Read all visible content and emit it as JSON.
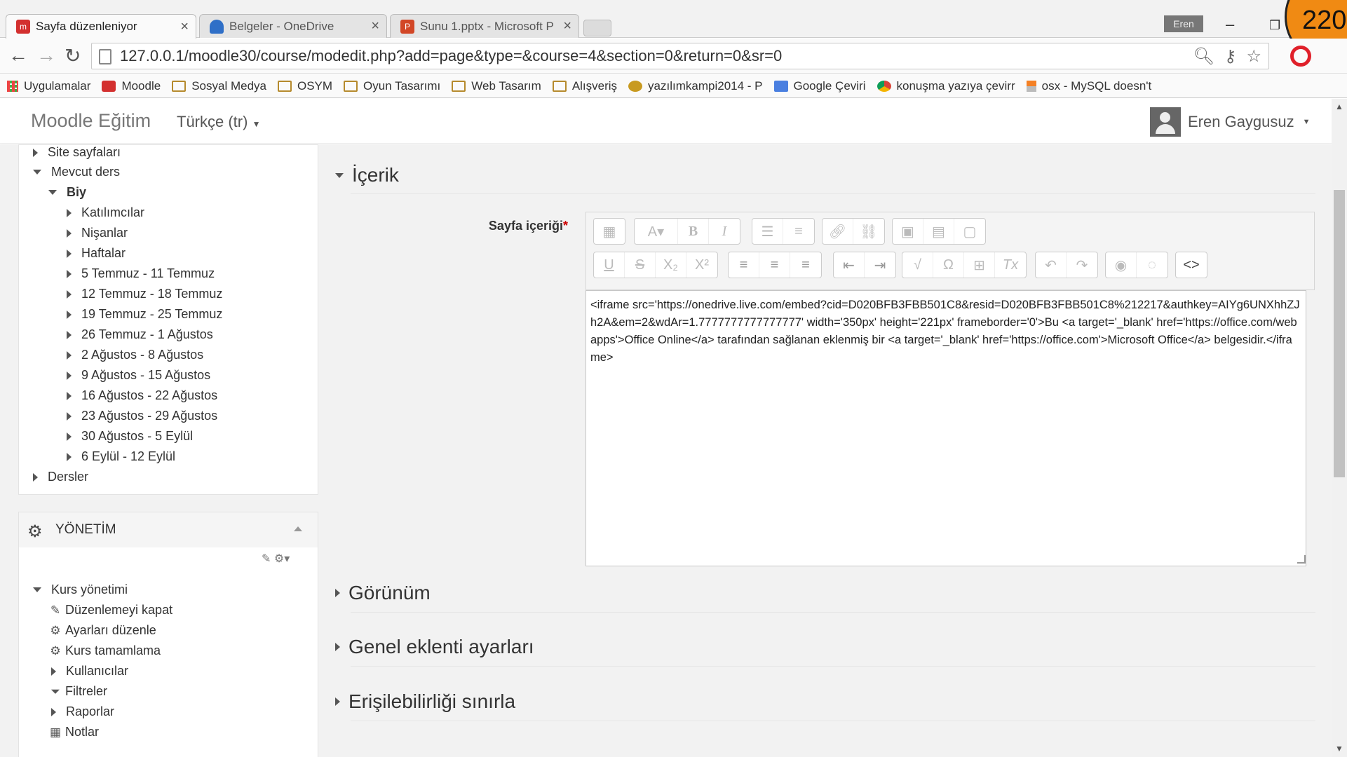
{
  "browser": {
    "tabs": [
      {
        "title": "Sayfa düzenleniyor",
        "favicon": "moodle-icon"
      },
      {
        "title": "Belgeler - OneDrive",
        "favicon": "onedrive-icon"
      },
      {
        "title": "Sunu 1.pptx - Microsoft P",
        "favicon": "powerpoint-icon"
      }
    ],
    "user_chip": "Eren",
    "url": "127.0.0.1/moodle30/course/modedit.php?add=page&type=&course=4&section=0&return=0&sr=0",
    "overlay_badge": "220",
    "bookmarks": [
      {
        "label": "Uygulamalar"
      },
      {
        "label": "Moodle"
      },
      {
        "label": "Sosyal Medya"
      },
      {
        "label": "OSYM"
      },
      {
        "label": "Oyun Tasarımı"
      },
      {
        "label": "Web Tasarım"
      },
      {
        "label": "Alışveriş"
      },
      {
        "label": "yazılımkampi2014 - P"
      },
      {
        "label": "Google Çeviri"
      },
      {
        "label": "konuşma yazıya çevirr"
      },
      {
        "label": "osx - MySQL doesn't"
      }
    ]
  },
  "navbar": {
    "brand": "Moodle Eğitim",
    "language": "Türkçe (tr)",
    "user": "Eren Gaygusuz"
  },
  "sidebar": {
    "nav": {
      "site_pages": "Site sayfaları",
      "current_course": "Mevcut ders",
      "course": "Biy",
      "items": [
        "Katılımcılar",
        "Nişanlar",
        "Haftalar",
        "5 Temmuz - 11 Temmuz",
        "12 Temmuz - 18 Temmuz",
        "19 Temmuz - 25 Temmuz",
        "26 Temmuz - 1 Ağustos",
        "2 Ağustos - 8 Ağustos",
        "9 Ağustos - 15 Ağustos",
        "16 Ağustos - 22 Ağustos",
        "23 Ağustos - 29 Ağustos",
        "30 Ağustos - 5 Eylül",
        "6 Eylül - 12 Eylül"
      ],
      "courses": "Dersler"
    },
    "admin": {
      "title": "YÖNETİM",
      "course_admin": "Kurs yönetimi",
      "items": [
        {
          "label": "Düzenlemeyi kapat",
          "icon": "pencil-icon"
        },
        {
          "label": "Ayarları düzenle",
          "icon": "gear-icon"
        },
        {
          "label": "Kurs tamamlama",
          "icon": "gear-icon"
        },
        {
          "label": "Kullanıcılar",
          "icon": "triangle-icon"
        },
        {
          "label": "Filtreler",
          "icon": "filter-icon"
        },
        {
          "label": "Raporlar",
          "icon": "triangle-icon"
        },
        {
          "label": "Notlar",
          "icon": "table-icon"
        }
      ]
    }
  },
  "main": {
    "content_section": "İçerik",
    "field_label": "Sayfa içeriği",
    "required_mark": "*",
    "editor_html": "<iframe src='https://onedrive.live.com/embed?cid=D020BFB3FBB501C8&resid=D020BFB3FBB501C8%212217&authkey=AIYg6UNXhhZJh2A&em=2&wdAr=1.7777777777777777' width='350px' height='221px' frameborder='0'>Bu <a target='_blank' href='https://office.com/webapps'>Office Online</a> tarafından sağlanan eklenmiş bir <a target='_blank' href='https://office.com'>Microsoft Office</a> belgesidir.</iframe>",
    "sections": [
      "Görünüm",
      "Genel eklenti ayarları",
      "Erişilebilirliği sınırla"
    ]
  }
}
